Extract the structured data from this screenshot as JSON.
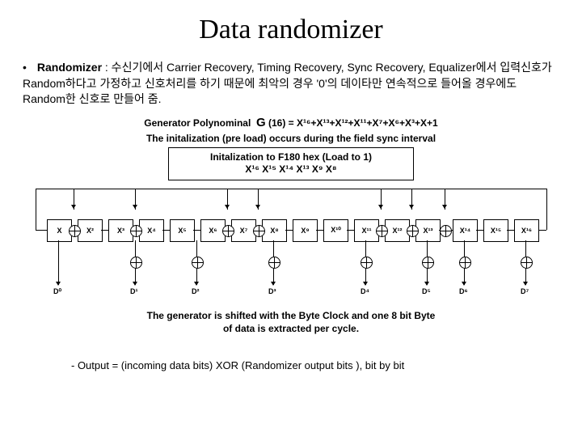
{
  "title": "Data randomizer",
  "bullet": {
    "lead": "Randomizer",
    "text": " : 수신기에서 Carrier Recovery, Timing Recovery, Sync Recovery, Equalizer에서 입력신호가 Random하다고 가정하고 신호처리를 하기 때문에 최악의 경우 '0'의 데이타만 연속적으로 들어올 경우에도 Random한 신호로 만들어 줌."
  },
  "poly": {
    "label": "Generator Polynominal",
    "g": "G",
    "sub": "(16)",
    "expr": " = X¹⁶+X¹³+X¹²+X¹¹+X⁷+X⁶+X³+X+1"
  },
  "preload": "The initalization (pre load) occurs during the field sync interval",
  "initbox": {
    "l1": "Initalization to F180 hex (Load to 1)",
    "l2": "X¹⁶ X¹⁵ X¹⁴ X¹³ X⁹ X⁸"
  },
  "regs": [
    "X",
    "X²",
    "X³",
    "X⁴",
    "X⁵",
    "X⁶",
    "X⁷",
    "X⁸",
    "X⁹",
    "X¹⁰",
    "X¹¹",
    "X¹²",
    "X¹³",
    "X¹⁴",
    "X¹⁵",
    "X¹⁶"
  ],
  "dlabels": [
    "D⁰",
    "D¹",
    "D²",
    "D³",
    "D⁴",
    "D⁵",
    "D⁶",
    "D⁷"
  ],
  "bottom": {
    "l1": "The generator is shifted with the Byte Clock and one 8 bit Byte",
    "l2": "of data is extracted per cycle."
  },
  "output": "- Output = (incoming data bits) XOR (Randomizer output bits ),  bit by bit",
  "chart_data": {
    "type": "diagram",
    "description": "16-stage linear feedback shift register (LFSR) data randomizer",
    "polynomial_taps": [
      16,
      13,
      12,
      11,
      7,
      6,
      3,
      1,
      0
    ],
    "initialization_hex": "F180",
    "initialization_bits_set": [
      "X16",
      "X15",
      "X14",
      "X13",
      "X9",
      "X8"
    ],
    "register_stages": 16,
    "output_byte_taps": [
      "D0",
      "D1",
      "D2",
      "D3",
      "D4",
      "D5",
      "D6",
      "D7"
    ],
    "output_rule": "incoming_bits XOR randomizer_bits (bitwise)"
  }
}
